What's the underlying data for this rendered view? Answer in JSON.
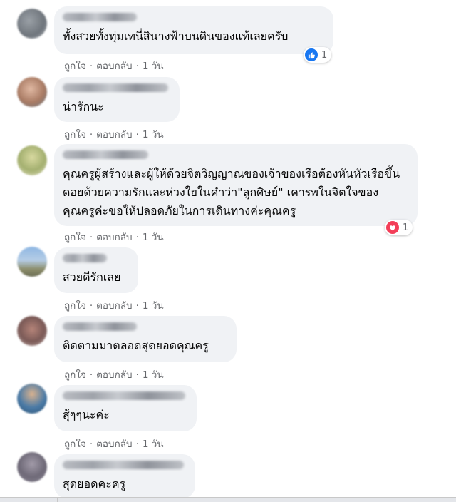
{
  "comments": [
    {
      "text": "ทั้งสวยทั้งทุ่มเทนี่สินางฟ้าบนดินของแท้เลยครับ",
      "like": "ถูกใจ",
      "reply": "ตอบกลับ",
      "time": "1 วัน",
      "reaction": {
        "type": "like",
        "count": "1"
      }
    },
    {
      "text": "น่ารักนะ",
      "like": "ถูกใจ",
      "reply": "ตอบกลับ",
      "time": "1 วัน"
    },
    {
      "text": "คุณครูผู้สร้างและผู้ให้ด้วยจิตวิญญาณของเจ้าของเรือต้องหันหัวเรือขึ้นดอยด้วยความรักและห่วงใยในคำว่า\"ลูกศิษย์\" เคารพในจิตใจของคุณครูค่ะขอให้ปลอดภัยในการเดินทางค่ะคุณครู",
      "like": "ถูกใจ",
      "reply": "ตอบกลับ",
      "time": "1 วัน",
      "reaction": {
        "type": "love",
        "count": "1"
      }
    },
    {
      "text": "สวยดีรักเลย",
      "like": "ถูกใจ",
      "reply": "ตอบกลับ",
      "time": "1 วัน"
    },
    {
      "text": "ติดตามมาตลอดสุดยอดคุณครู",
      "like": "ถูกใจ",
      "reply": "ตอบกลับ",
      "time": "1 วัน"
    },
    {
      "text": "สุ้ๆๆนะค่ะ",
      "like": "ถูกใจ",
      "reply": "ตอบกลับ",
      "time": "1 วัน"
    },
    {
      "text": "สุดยอดคะครู"
    }
  ],
  "colors": {
    "bubble": "#f0f2f5",
    "meta": "#65676b",
    "like_blue": "#1877f2",
    "love_red": "#f33e58"
  },
  "icons": {
    "like": "thumbs-up-icon",
    "love": "heart-icon"
  }
}
